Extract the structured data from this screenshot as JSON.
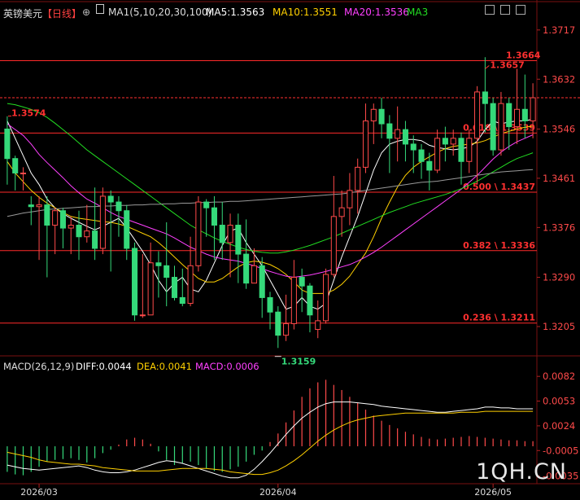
{
  "header": {
    "symbol": "英镑美元",
    "period": "【日线】",
    "indicator_name": "MA1(5,10,20,30,100)",
    "ma5": "MA5:1.3563",
    "ma10": "MA10:1.3551",
    "ma20": "MA20:1.3536",
    "ma3": "MA3",
    "colors": {
      "symbol": "#e0e0e0",
      "period": "#ff4040",
      "ma5": "#ffffff",
      "ma10": "#ffd000",
      "ma20": "#ff40ff",
      "ma3": "#22dd22"
    }
  },
  "macd_header": {
    "name": "MACD(26,12,9)",
    "diff": "DIFF:0.0044",
    "dea": "DEA:0.0041",
    "macd": "MACD:0.0006"
  },
  "logo": "1QH.CN",
  "chart_data": [
    {
      "type": "candlestick",
      "title": "英镑美元 【日线】",
      "ylim": [
        1.316,
        1.3735
      ],
      "y_ticks": [
        "1.3717",
        "1.3632",
        "1.3546",
        "1.3461",
        "1.3376",
        "1.3290",
        "1.3205"
      ],
      "x_ticks": [
        "2026/03",
        "2026/04",
        "2026/05"
      ],
      "current_price": 1.36,
      "fib_levels": [
        {
          "label": "1.3664",
          "value": 1.3664
        },
        {
          "label": "0.618 \\ 1.3539",
          "value": 1.3539
        },
        {
          "label": "0.500 \\ 1.3437",
          "value": 1.3437
        },
        {
          "label": "0.382 \\ 1.3336",
          "value": 1.3336
        },
        {
          "label": "0.236 \\ 1.3211",
          "value": 1.3211
        }
      ],
      "annotations": [
        {
          "text": "1.3574",
          "value": 1.3574
        },
        {
          "text": "1.3657",
          "value": 1.3657
        },
        {
          "text": "1.3159",
          "value": 1.3159
        }
      ],
      "candles": [
        [
          1.3546,
          1.3495,
          1.3568,
          1.345
        ],
        [
          1.3495,
          1.347,
          1.35,
          1.344
        ],
        [
          1.347,
          1.347,
          1.348,
          1.344
        ],
        [
          1.3415,
          1.3412,
          1.343,
          1.338
        ],
        [
          1.3412,
          1.3415,
          1.343,
          1.332
        ],
        [
          1.3415,
          1.338,
          1.343,
          1.329
        ],
        [
          1.338,
          1.3405,
          1.341,
          1.333
        ],
        [
          1.3405,
          1.3375,
          1.341,
          1.334
        ],
        [
          1.3375,
          1.338,
          1.3395,
          1.333
        ],
        [
          1.338,
          1.336,
          1.3405,
          1.332
        ],
        [
          1.336,
          1.337,
          1.3415,
          1.335
        ],
        [
          1.337,
          1.334,
          1.3445,
          1.332
        ],
        [
          1.334,
          1.343,
          1.3445,
          1.333
        ],
        [
          1.343,
          1.342,
          1.344,
          1.33
        ],
        [
          1.342,
          1.3405,
          1.343,
          1.336
        ],
        [
          1.3405,
          1.334,
          1.3415,
          1.332
        ],
        [
          1.334,
          1.3225,
          1.335,
          1.3215
        ],
        [
          1.3225,
          1.3225,
          1.333,
          1.322
        ],
        [
          1.3225,
          1.3315,
          1.335,
          1.324
        ],
        [
          1.3315,
          1.331,
          1.3335,
          1.3255
        ],
        [
          1.331,
          1.329,
          1.3385,
          1.324
        ],
        [
          1.329,
          1.3255,
          1.331,
          1.325
        ],
        [
          1.3255,
          1.3245,
          1.3305,
          1.324
        ],
        [
          1.3245,
          1.331,
          1.336,
          1.324
        ],
        [
          1.331,
          1.342,
          1.343,
          1.33
        ],
        [
          1.342,
          1.341,
          1.3425,
          1.336
        ],
        [
          1.341,
          1.338,
          1.343,
          1.332
        ],
        [
          1.338,
          1.335,
          1.342,
          1.332
        ],
        [
          1.335,
          1.338,
          1.34,
          1.329
        ],
        [
          1.338,
          1.333,
          1.34,
          1.328
        ],
        [
          1.333,
          1.328,
          1.339,
          1.327
        ],
        [
          1.328,
          1.331,
          1.334,
          1.328
        ],
        [
          1.331,
          1.3255,
          1.3325,
          1.322
        ],
        [
          1.3255,
          1.323,
          1.3265,
          1.32
        ],
        [
          1.323,
          1.319,
          1.324,
          1.3168
        ],
        [
          1.319,
          1.321,
          1.326,
          1.318
        ],
        [
          1.321,
          1.329,
          1.332,
          1.32
        ],
        [
          1.329,
          1.3275,
          1.3305,
          1.323
        ],
        [
          1.3275,
          1.3225,
          1.328,
          1.3195
        ],
        [
          1.32,
          1.3215,
          1.325,
          1.3185
        ],
        [
          1.3215,
          1.3295,
          1.3305,
          1.321
        ],
        [
          1.3295,
          1.3395,
          1.3465,
          1.329
        ],
        [
          1.3395,
          1.341,
          1.344,
          1.336
        ],
        [
          1.341,
          1.344,
          1.347,
          1.338
        ],
        [
          1.344,
          1.348,
          1.3495,
          1.34
        ],
        [
          1.348,
          1.356,
          1.359,
          1.347
        ],
        [
          1.356,
          1.358,
          1.359,
          1.352
        ],
        [
          1.358,
          1.3555,
          1.36,
          1.353
        ],
        [
          1.3555,
          1.353,
          1.357,
          1.347
        ],
        [
          1.353,
          1.3545,
          1.3585,
          1.349
        ],
        [
          1.3545,
          1.352,
          1.356,
          1.349
        ],
        [
          1.352,
          1.351,
          1.3535,
          1.347
        ],
        [
          1.351,
          1.349,
          1.352,
          1.346
        ],
        [
          1.349,
          1.3475,
          1.3505,
          1.344
        ],
        [
          1.3475,
          1.353,
          1.3545,
          1.347
        ],
        [
          1.353,
          1.352,
          1.355,
          1.349
        ],
        [
          1.352,
          1.353,
          1.3545,
          1.35
        ],
        [
          1.353,
          1.349,
          1.354,
          1.345
        ],
        [
          1.349,
          1.353,
          1.3545,
          1.347
        ],
        [
          1.353,
          1.361,
          1.362,
          1.345
        ],
        [
          1.361,
          1.359,
          1.367,
          1.354
        ],
        [
          1.359,
          1.351,
          1.36,
          1.35
        ],
        [
          1.351,
          1.359,
          1.361,
          1.35
        ],
        [
          1.359,
          1.355,
          1.36,
          1.351
        ],
        [
          1.355,
          1.358,
          1.365,
          1.352
        ],
        [
          1.358,
          1.356,
          1.364,
          1.353
        ],
        [
          1.356,
          1.36,
          1.3625,
          1.353
        ]
      ],
      "series": [
        {
          "name": "MA5",
          "color": "#ffffff",
          "values": [
            1.356,
            1.353,
            1.35,
            1.347,
            1.345,
            1.3425,
            1.341,
            1.34,
            1.3392,
            1.3385,
            1.3378,
            1.3372,
            1.3378,
            1.3385,
            1.3392,
            1.3375,
            1.3355,
            1.3335,
            1.3312,
            1.3285,
            1.3265,
            1.328,
            1.329,
            1.327,
            1.3265,
            1.3285,
            1.3315,
            1.3345,
            1.337,
            1.3375,
            1.335,
            1.333,
            1.331,
            1.3285,
            1.326,
            1.3235,
            1.324,
            1.3255,
            1.324,
            1.3235,
            1.3245,
            1.3285,
            1.3325,
            1.336,
            1.3395,
            1.3435,
            1.3475,
            1.3505,
            1.352,
            1.3525,
            1.3528,
            1.3528,
            1.3526,
            1.3518,
            1.3514,
            1.3512,
            1.351,
            1.3512,
            1.3515,
            1.3525,
            1.3545,
            1.356,
            1.3555,
            1.3558,
            1.356,
            1.356,
            1.3563
          ]
        },
        {
          "name": "MA10",
          "color": "#ffd000",
          "values": [
            1.349,
            1.347,
            1.3455,
            1.344,
            1.3428,
            1.3418,
            1.341,
            1.3402,
            1.3395,
            1.3392,
            1.339,
            1.3388,
            1.3386,
            1.3385,
            1.3382,
            1.3378,
            1.3372,
            1.3366,
            1.336,
            1.335,
            1.3338,
            1.3325,
            1.3312,
            1.33,
            1.3288,
            1.3282,
            1.3282,
            1.3288,
            1.3298,
            1.3308,
            1.3315,
            1.3318,
            1.3316,
            1.3312,
            1.3305,
            1.3295,
            1.3282,
            1.3268,
            1.3262,
            1.3262,
            1.3262,
            1.3268,
            1.3278,
            1.3292,
            1.3312,
            1.3332,
            1.336,
            1.3392,
            1.342,
            1.3446,
            1.3466,
            1.348,
            1.349,
            1.3498,
            1.3506,
            1.3512,
            1.3516,
            1.3518,
            1.352,
            1.3522,
            1.3526,
            1.3532,
            1.3538,
            1.3542,
            1.3546,
            1.3549,
            1.3551
          ]
        },
        {
          "name": "MA20",
          "color": "#ff40ff",
          "values": [
            1.3555,
            1.3545,
            1.3535,
            1.352,
            1.3502,
            1.3488,
            1.3475,
            1.3462,
            1.3448,
            1.3436,
            1.3425,
            1.3418,
            1.341,
            1.3402,
            1.3395,
            1.339,
            1.3385,
            1.338,
            1.3375,
            1.337,
            1.3365,
            1.3358,
            1.335,
            1.3342,
            1.3336,
            1.333,
            1.3325,
            1.3322,
            1.332,
            1.3318,
            1.3314,
            1.331,
            1.3305,
            1.33,
            1.3296,
            1.3292,
            1.329,
            1.3292,
            1.3294,
            1.3297,
            1.33,
            1.3304,
            1.3308,
            1.3312,
            1.3318,
            1.3325,
            1.3333,
            1.3342,
            1.3352,
            1.3362,
            1.3372,
            1.3382,
            1.3392,
            1.3402,
            1.3412,
            1.3422,
            1.3432,
            1.3442,
            1.3454,
            1.3466,
            1.348,
            1.3494,
            1.3506,
            1.3516,
            1.3524,
            1.353,
            1.3536
          ]
        },
        {
          "name": "MA30",
          "color": "#22dd22",
          "values": [
            1.359,
            1.3588,
            1.3584,
            1.358,
            1.3574,
            1.3566,
            1.3556,
            1.3545,
            1.3534,
            1.3522,
            1.351,
            1.35,
            1.349,
            1.348,
            1.347,
            1.346,
            1.345,
            1.344,
            1.343,
            1.342,
            1.341,
            1.34,
            1.339,
            1.338,
            1.3372,
            1.3365,
            1.3358,
            1.3352,
            1.3347,
            1.3342,
            1.3338,
            1.3335,
            1.3333,
            1.3332,
            1.3332,
            1.3334,
            1.3337,
            1.3341,
            1.3345,
            1.335,
            1.3355,
            1.336,
            1.3366,
            1.3372,
            1.3378,
            1.3384,
            1.339,
            1.3396,
            1.3402,
            1.3407,
            1.3412,
            1.3417,
            1.3421,
            1.3425,
            1.3429,
            1.3433,
            1.3438,
            1.3443,
            1.3449,
            1.3456,
            1.3464,
            1.3472,
            1.348,
            1.3488,
            1.3495,
            1.35,
            1.3505
          ]
        },
        {
          "name": "MA100",
          "color": "#999999",
          "values": [
            1.3395,
            1.3398,
            1.3401,
            1.3403,
            1.3405,
            1.3407,
            1.3408,
            1.3409,
            1.341,
            1.3411,
            1.3412,
            1.3412,
            1.3413,
            1.3413,
            1.3414,
            1.3414,
            1.3415,
            1.3415,
            1.3416,
            1.3416,
            1.3417,
            1.3417,
            1.3418,
            1.3418,
            1.3419,
            1.3419,
            1.342,
            1.342,
            1.3421,
            1.3421,
            1.3422,
            1.3423,
            1.3424,
            1.3425,
            1.3426,
            1.3427,
            1.3428,
            1.3429,
            1.343,
            1.3431,
            1.3432,
            1.3433,
            1.3434,
            1.3436,
            1.3438,
            1.344,
            1.3442,
            1.3444,
            1.3446,
            1.3448,
            1.345,
            1.3452,
            1.3454,
            1.3455,
            1.3456,
            1.3458,
            1.346,
            1.3462,
            1.3464,
            1.3466,
            1.3468,
            1.347,
            1.3472,
            1.3473,
            1.3474,
            1.3475,
            1.3476
          ]
        }
      ]
    },
    {
      "type": "macd",
      "title": "MACD(26,12,9)",
      "ylim": [
        -0.0042,
        0.0086
      ],
      "y_ticks": [
        "0.0082",
        "0.0053",
        "0.0024",
        "-0.0005",
        "-0.0035"
      ],
      "histogram": [
        -0.003,
        -0.0033,
        -0.0034,
        -0.003,
        -0.0024,
        -0.0018,
        -0.0016,
        -0.0015,
        -0.0014,
        -0.0016,
        -0.0019,
        -0.0014,
        -0.0008,
        -0.0004,
        0.0002,
        0.0008,
        0.001,
        0.0008,
        0.0003,
        -0.0006,
        -0.0016,
        -0.0022,
        -0.002,
        -0.0018,
        -0.0022,
        -0.0026,
        -0.0029,
        -0.003,
        -0.0027,
        -0.0024,
        -0.0018,
        -0.001,
        -0.0005,
        0.0005,
        0.0015,
        0.0028,
        0.0042,
        0.0058,
        0.0068,
        0.0075,
        0.0078,
        0.0072,
        0.0066,
        0.0058,
        0.0051,
        0.0043,
        0.0036,
        0.003,
        0.0025,
        0.0021,
        0.0017,
        0.0014,
        0.0011,
        0.0009,
        0.0008,
        0.0009,
        0.001,
        0.0011,
        0.0012,
        0.0011,
        0.001,
        0.0009,
        0.0008,
        0.0007,
        0.0007,
        0.0006,
        0.0006
      ],
      "series": [
        {
          "name": "DIFF",
          "color": "#ffffff",
          "values": [
            -0.0022,
            -0.0024,
            -0.0026,
            -0.0027,
            -0.0028,
            -0.0027,
            -0.0026,
            -0.0025,
            -0.0024,
            -0.0023,
            -0.0025,
            -0.0028,
            -0.003,
            -0.0031,
            -0.0031,
            -0.003,
            -0.0028,
            -0.0025,
            -0.0022,
            -0.0019,
            -0.0017,
            -0.0018,
            -0.002,
            -0.0023,
            -0.0026,
            -0.0029,
            -0.0032,
            -0.0035,
            -0.0037,
            -0.0037,
            -0.0034,
            -0.0027,
            -0.0018,
            -0.0008,
            0.0003,
            0.0014,
            0.0024,
            0.0033,
            0.004,
            0.0046,
            0.005,
            0.0052,
            0.0052,
            0.0052,
            0.0051,
            0.005,
            0.0049,
            0.0047,
            0.0046,
            0.0045,
            0.0044,
            0.0043,
            0.0042,
            0.0041,
            0.004,
            0.004,
            0.0041,
            0.0042,
            0.0043,
            0.0044,
            0.0046,
            0.0046,
            0.0045,
            0.0045,
            0.0044,
            0.0044,
            0.0044
          ]
        },
        {
          "name": "DEA",
          "color": "#ffd000",
          "values": [
            -0.0007,
            -0.0009,
            -0.0011,
            -0.0013,
            -0.0016,
            -0.0018,
            -0.0019,
            -0.002,
            -0.0021,
            -0.0021,
            -0.0022,
            -0.0023,
            -0.0025,
            -0.0026,
            -0.0027,
            -0.0028,
            -0.0029,
            -0.0029,
            -0.0029,
            -0.0029,
            -0.0028,
            -0.0027,
            -0.0026,
            -0.0026,
            -0.0026,
            -0.0026,
            -0.0027,
            -0.0028,
            -0.003,
            -0.0031,
            -0.0032,
            -0.0033,
            -0.0033,
            -0.0031,
            -0.0028,
            -0.0023,
            -0.0017,
            -0.001,
            -0.0002,
            0.0006,
            0.0013,
            0.0019,
            0.0024,
            0.0028,
            0.0031,
            0.0033,
            0.0035,
            0.0036,
            0.0037,
            0.0038,
            0.0039,
            0.0039,
            0.0039,
            0.0039,
            0.0039,
            0.0039,
            0.0039,
            0.004,
            0.004,
            0.004,
            0.0041,
            0.0041,
            0.0041,
            0.0041,
            0.0041,
            0.0041,
            0.0041
          ]
        }
      ]
    }
  ]
}
